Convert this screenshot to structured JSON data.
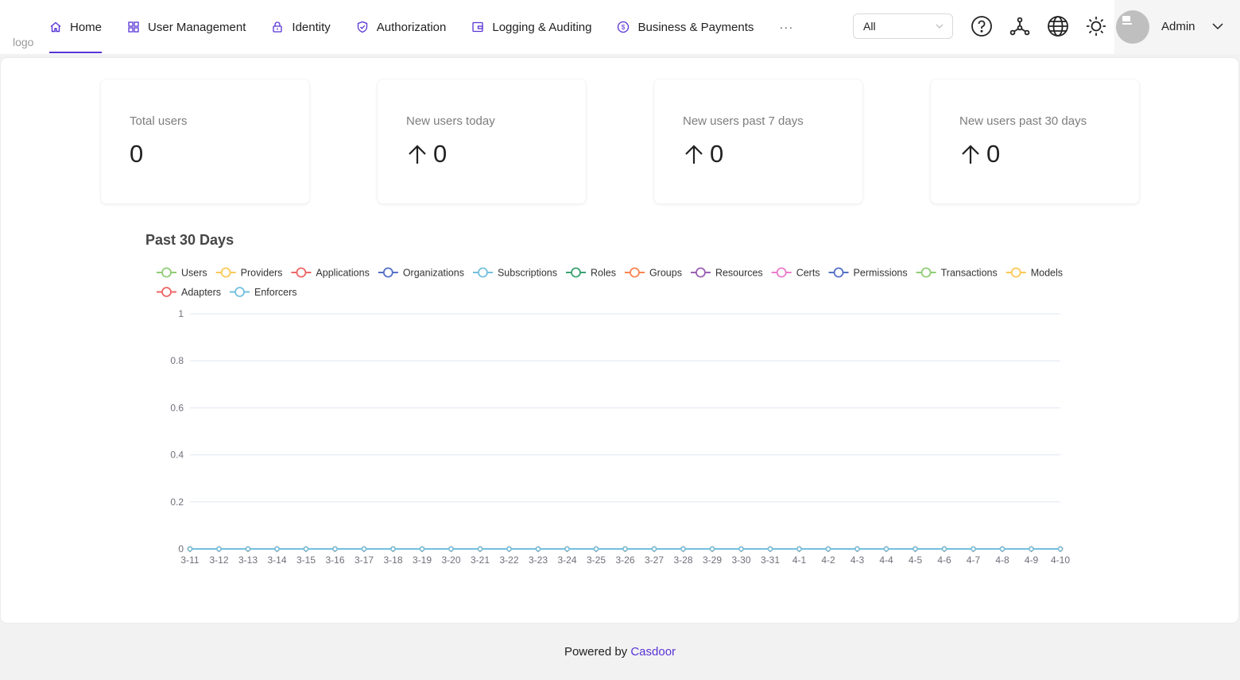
{
  "header": {
    "logo_text": "logo",
    "nav": [
      {
        "label": "Home",
        "icon": "home-icon",
        "active": true
      },
      {
        "label": "User Management",
        "icon": "grid-icon"
      },
      {
        "label": "Identity",
        "icon": "lock-icon"
      },
      {
        "label": "Authorization",
        "icon": "shield-icon"
      },
      {
        "label": "Logging & Auditing",
        "icon": "wallet-icon"
      },
      {
        "label": "Business & Payments",
        "icon": "dollar-circle-icon"
      }
    ],
    "more": "···",
    "org_select": {
      "value": "All"
    },
    "icons": [
      "help-icon",
      "network-icon",
      "globe-icon",
      "theme-sun-icon"
    ],
    "user": {
      "name": "Admin"
    }
  },
  "stats": [
    {
      "title": "Total users",
      "value": "0",
      "arrow": false
    },
    {
      "title": "New users today",
      "value": "0",
      "arrow": true
    },
    {
      "title": "New users past 7 days",
      "value": "0",
      "arrow": true
    },
    {
      "title": "New users past 30 days",
      "value": "0",
      "arrow": true
    }
  ],
  "chart_title": "Past 30 Days",
  "chart_data": {
    "type": "line",
    "ylim": [
      0,
      1
    ],
    "yticks": [
      "0",
      "0.2",
      "0.4",
      "0.6",
      "0.8",
      "1"
    ],
    "categories": [
      "3-11",
      "3-12",
      "3-13",
      "3-14",
      "3-15",
      "3-16",
      "3-17",
      "3-18",
      "3-19",
      "3-20",
      "3-21",
      "3-22",
      "3-23",
      "3-24",
      "3-25",
      "3-26",
      "3-27",
      "3-28",
      "3-29",
      "3-30",
      "3-31",
      "4-1",
      "4-2",
      "4-3",
      "4-4",
      "4-5",
      "4-6",
      "4-7",
      "4-8",
      "4-9",
      "4-10"
    ],
    "grid": true,
    "legend_position": "top-left",
    "series": [
      {
        "name": "Users",
        "color": "#91cc75",
        "values": [
          0,
          0,
          0,
          0,
          0,
          0,
          0,
          0,
          0,
          0,
          0,
          0,
          0,
          0,
          0,
          0,
          0,
          0,
          0,
          0,
          0,
          0,
          0,
          0,
          0,
          0,
          0,
          0,
          0,
          0,
          0
        ]
      },
      {
        "name": "Providers",
        "color": "#fac858",
        "values": [
          0,
          0,
          0,
          0,
          0,
          0,
          0,
          0,
          0,
          0,
          0,
          0,
          0,
          0,
          0,
          0,
          0,
          0,
          0,
          0,
          0,
          0,
          0,
          0,
          0,
          0,
          0,
          0,
          0,
          0,
          0
        ]
      },
      {
        "name": "Applications",
        "color": "#ee6666",
        "values": [
          0,
          0,
          0,
          0,
          0,
          0,
          0,
          0,
          0,
          0,
          0,
          0,
          0,
          0,
          0,
          0,
          0,
          0,
          0,
          0,
          0,
          0,
          0,
          0,
          0,
          0,
          0,
          0,
          0,
          0,
          0
        ]
      },
      {
        "name": "Organizations",
        "color": "#5470c6",
        "values": [
          0,
          0,
          0,
          0,
          0,
          0,
          0,
          0,
          0,
          0,
          0,
          0,
          0,
          0,
          0,
          0,
          0,
          0,
          0,
          0,
          0,
          0,
          0,
          0,
          0,
          0,
          0,
          0,
          0,
          0,
          0
        ]
      },
      {
        "name": "Subscriptions",
        "color": "#73c0de",
        "values": [
          0,
          0,
          0,
          0,
          0,
          0,
          0,
          0,
          0,
          0,
          0,
          0,
          0,
          0,
          0,
          0,
          0,
          0,
          0,
          0,
          0,
          0,
          0,
          0,
          0,
          0,
          0,
          0,
          0,
          0,
          0
        ]
      },
      {
        "name": "Roles",
        "color": "#3ba272",
        "values": [
          0,
          0,
          0,
          0,
          0,
          0,
          0,
          0,
          0,
          0,
          0,
          0,
          0,
          0,
          0,
          0,
          0,
          0,
          0,
          0,
          0,
          0,
          0,
          0,
          0,
          0,
          0,
          0,
          0,
          0,
          0
        ]
      },
      {
        "name": "Groups",
        "color": "#fc8452",
        "values": [
          0,
          0,
          0,
          0,
          0,
          0,
          0,
          0,
          0,
          0,
          0,
          0,
          0,
          0,
          0,
          0,
          0,
          0,
          0,
          0,
          0,
          0,
          0,
          0,
          0,
          0,
          0,
          0,
          0,
          0,
          0
        ]
      },
      {
        "name": "Resources",
        "color": "#9a60b4",
        "values": [
          0,
          0,
          0,
          0,
          0,
          0,
          0,
          0,
          0,
          0,
          0,
          0,
          0,
          0,
          0,
          0,
          0,
          0,
          0,
          0,
          0,
          0,
          0,
          0,
          0,
          0,
          0,
          0,
          0,
          0,
          0
        ]
      },
      {
        "name": "Certs",
        "color": "#ea7ccc",
        "values": [
          0,
          0,
          0,
          0,
          0,
          0,
          0,
          0,
          0,
          0,
          0,
          0,
          0,
          0,
          0,
          0,
          0,
          0,
          0,
          0,
          0,
          0,
          0,
          0,
          0,
          0,
          0,
          0,
          0,
          0,
          0
        ]
      },
      {
        "name": "Permissions",
        "color": "#5470c6",
        "values": [
          0,
          0,
          0,
          0,
          0,
          0,
          0,
          0,
          0,
          0,
          0,
          0,
          0,
          0,
          0,
          0,
          0,
          0,
          0,
          0,
          0,
          0,
          0,
          0,
          0,
          0,
          0,
          0,
          0,
          0,
          0
        ]
      },
      {
        "name": "Transactions",
        "color": "#91cc75",
        "values": [
          0,
          0,
          0,
          0,
          0,
          0,
          0,
          0,
          0,
          0,
          0,
          0,
          0,
          0,
          0,
          0,
          0,
          0,
          0,
          0,
          0,
          0,
          0,
          0,
          0,
          0,
          0,
          0,
          0,
          0,
          0
        ]
      },
      {
        "name": "Models",
        "color": "#fac858",
        "values": [
          0,
          0,
          0,
          0,
          0,
          0,
          0,
          0,
          0,
          0,
          0,
          0,
          0,
          0,
          0,
          0,
          0,
          0,
          0,
          0,
          0,
          0,
          0,
          0,
          0,
          0,
          0,
          0,
          0,
          0,
          0
        ]
      },
      {
        "name": "Adapters",
        "color": "#ee6666",
        "values": [
          0,
          0,
          0,
          0,
          0,
          0,
          0,
          0,
          0,
          0,
          0,
          0,
          0,
          0,
          0,
          0,
          0,
          0,
          0,
          0,
          0,
          0,
          0,
          0,
          0,
          0,
          0,
          0,
          0,
          0,
          0
        ]
      },
      {
        "name": "Enforcers",
        "color": "#73c0de",
        "values": [
          0,
          0,
          0,
          0,
          0,
          0,
          0,
          0,
          0,
          0,
          0,
          0,
          0,
          0,
          0,
          0,
          0,
          0,
          0,
          0,
          0,
          0,
          0,
          0,
          0,
          0,
          0,
          0,
          0,
          0,
          0
        ]
      }
    ]
  },
  "footer": {
    "prefix": "Powered by",
    "link": "Casdoor"
  },
  "colors": {
    "accent": "#5734d3"
  }
}
